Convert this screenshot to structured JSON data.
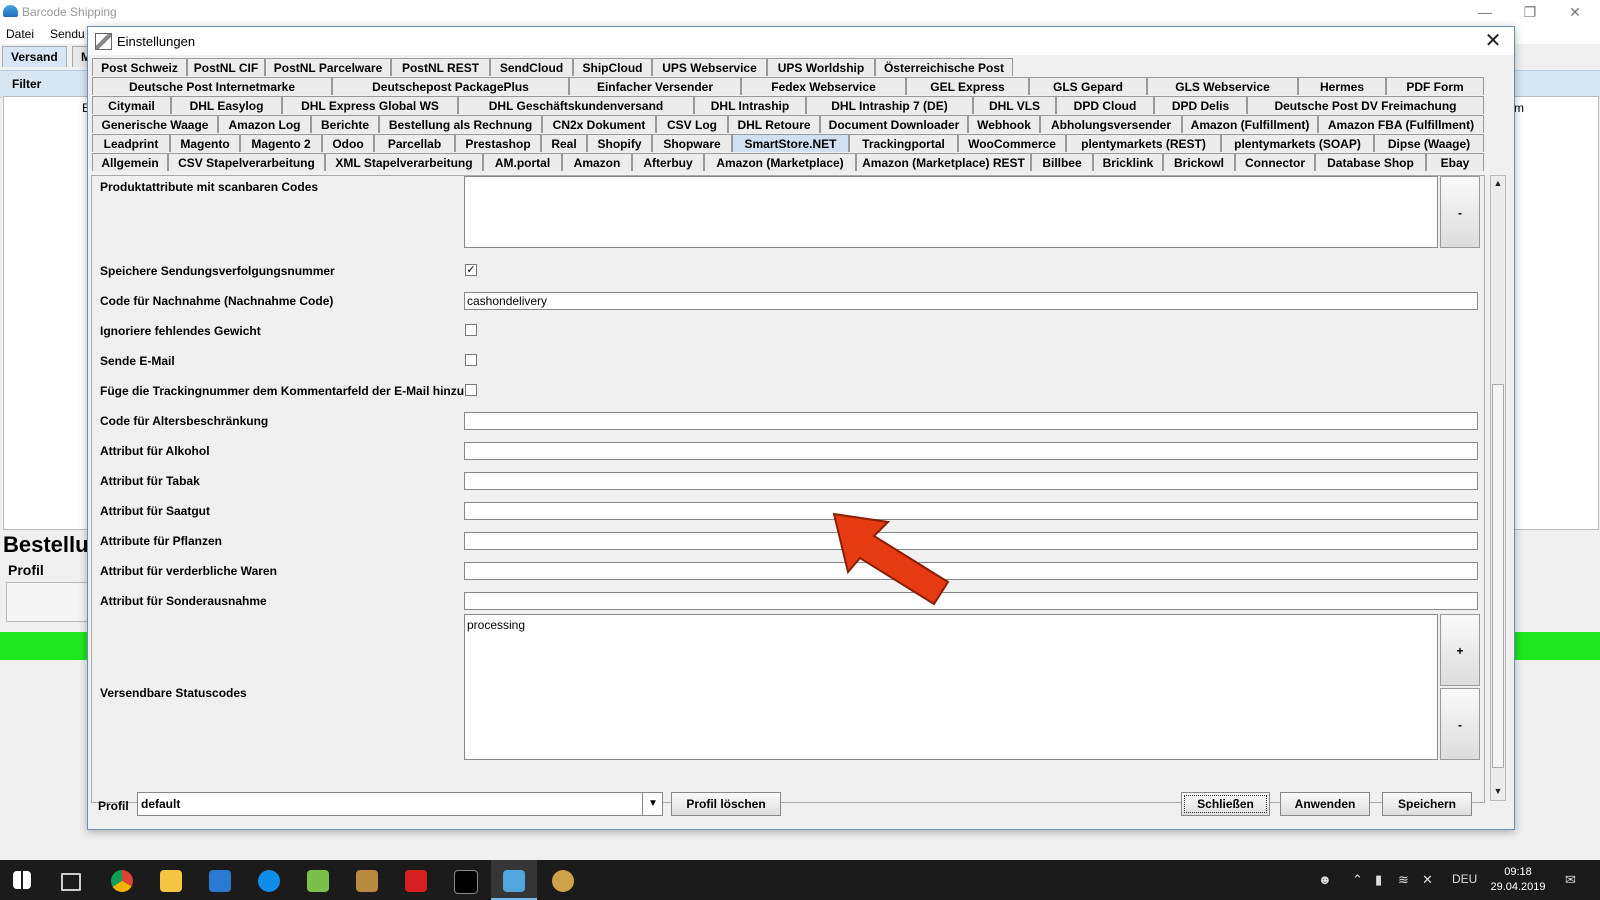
{
  "app": {
    "title": "Barcode Shipping",
    "menus": [
      "Datei",
      "Sendu"
    ],
    "tabs": [
      "Versand",
      "M"
    ],
    "filter_label": "Filter",
    "partial_heading": "Bestellu",
    "profil_label": "Profil",
    "right_col_partial": "m",
    "left_col_partial": "E"
  },
  "dialog": {
    "title": "Einstellungen",
    "tab_rows": [
      [
        "Post Schweiz",
        "PostNL CIF",
        "PostNL Parcelware",
        "PostNL REST",
        "SendCloud",
        "ShipCloud",
        "UPS Webservice",
        "UPS Worldship",
        "Österreichische Post"
      ],
      [
        "Deutsche Post Internetmarke",
        "Deutschepost PackagePlus",
        "Einfacher Versender",
        "Fedex Webservice",
        "GEL Express",
        "GLS Gepard",
        "GLS Webservice",
        "Hermes",
        "PDF Form"
      ],
      [
        "Citymail",
        "DHL Easylog",
        "DHL Express Global WS",
        "DHL Geschäftskundenversand",
        "DHL Intraship",
        "DHL Intraship 7 (DE)",
        "DHL VLS",
        "DPD Cloud",
        "DPD Delis",
        "Deutsche Post DV Freimachung"
      ],
      [
        "Generische Waage",
        "Amazon Log",
        "Berichte",
        "Bestellung als Rechnung",
        "CN2x Dokument",
        "CSV Log",
        "DHL Retoure",
        "Document Downloader",
        "Webhook",
        "Abholungsversender",
        "Amazon (Fulfillment)",
        "Amazon FBA (Fulfillment)"
      ],
      [
        "Leadprint",
        "Magento",
        "Magento 2",
        "Odoo",
        "Parcellab",
        "Prestashop",
        "Real",
        "Shopify",
        "Shopware",
        "SmartStore.NET",
        "Trackingportal",
        "WooCommerce",
        "plentymarkets (REST)",
        "plentymarkets (SOAP)",
        "Dipse (Waage)"
      ],
      [
        "Allgemein",
        "CSV Stapelverarbeitung",
        "XML Stapelverarbeitung",
        "AM.portal",
        "Amazon",
        "Afterbuy",
        "Amazon (Marketplace)",
        "Amazon (Marketplace) REST",
        "Billbee",
        "Bricklink",
        "Brickowl",
        "Connector",
        "Database Shop",
        "Ebay"
      ]
    ],
    "selected_tab": "SmartStore.NET",
    "fields": {
      "produktattribute_label": "Produktattribute mit scanbaren Codes",
      "produktattribute_value": "",
      "speichere_label": "Speichere Sendungsverfolgungsnummer",
      "speichere_checked": true,
      "nachnahme_label": "Code für Nachnahme (Nachnahme Code)",
      "nachnahme_value": "cashondelivery",
      "gewicht_label": "Ignoriere fehlendes Gewicht",
      "gewicht_checked": false,
      "email_label": "Sende E-Mail",
      "email_checked": false,
      "tracking_label": "Füge die Trackingnummer dem Kommentarfeld der E-Mail hinzu",
      "tracking_checked": false,
      "alter_label": "Code für Altersbeschränkung",
      "alter_value": "",
      "alkohol_label": "Attribut für Alkohol",
      "alkohol_value": "",
      "tabak_label": "Attribut für Tabak",
      "tabak_value": "",
      "saatgut_label": "Attribut für Saatgut",
      "saatgut_value": "",
      "pflanzen_label": "Attribute für Pflanzen",
      "pflanzen_value": "",
      "verderblich_label": "Attribut für verderbliche Waren",
      "verderblich_value": "",
      "sonder_label": "Attribut für Sonderausnahme",
      "sonder_value": "",
      "status_label": "Versendbare Statuscodes",
      "status_value": "processing"
    },
    "list_buttons": {
      "minus": "-",
      "plus": "+"
    },
    "footer": {
      "profil_label": "Profil",
      "profil_value": "default",
      "delete_label": "Profil löschen",
      "close_label": "Schließen",
      "apply_label": "Anwenden",
      "save_label": "Speichern"
    }
  },
  "taskbar": {
    "language": "DEU",
    "time": "09:18",
    "date": "29.04.2019"
  },
  "colors": {
    "selected_tab": "#cfe0f2",
    "status_bar_green": "#1ee61e",
    "annotation_arrow": "#e63a12",
    "taskbar": "#1b1b1b"
  }
}
